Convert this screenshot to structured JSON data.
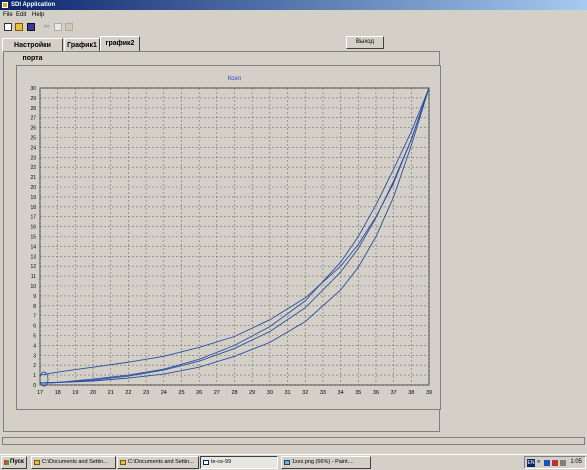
{
  "window": {
    "title": "SDI Application"
  },
  "menu": [
    "File",
    "Edit",
    "Help"
  ],
  "toolbar": {
    "icons": [
      "new-icon",
      "open-icon",
      "save-icon",
      "cut-icon",
      "copy-icon",
      "paste-icon"
    ]
  },
  "tabs": [
    "Настройки порта",
    "График1",
    "график2"
  ],
  "active_tab": 2,
  "exit_button": "Выход",
  "colors": {
    "series": "#2a4fa0",
    "grid": "#707070",
    "accent": "#0a246a"
  },
  "chart_data": {
    "type": "line",
    "title": "Ксил",
    "xlabel": "",
    "ylabel": "",
    "xlim": [
      17,
      39
    ],
    "ylim": [
      0,
      30
    ],
    "x_ticks": [
      17,
      18,
      19,
      20,
      21,
      22,
      23,
      24,
      25,
      26,
      27,
      28,
      29,
      30,
      31,
      32,
      33,
      34,
      35,
      36,
      37,
      38,
      39
    ],
    "y_ticks": [
      0,
      1,
      2,
      3,
      4,
      5,
      6,
      7,
      8,
      9,
      10,
      11,
      12,
      13,
      14,
      15,
      16,
      17,
      18,
      19,
      20,
      21,
      22,
      23,
      24,
      25,
      26,
      27,
      28,
      29,
      30
    ],
    "grid": true,
    "series": [
      {
        "x": [
          17,
          18,
          20,
          22,
          24,
          26,
          28,
          30,
          32,
          34,
          35,
          36,
          37,
          38,
          39
        ],
        "y": [
          1.0,
          1.3,
          1.8,
          2.3,
          2.9,
          3.8,
          4.9,
          6.6,
          8.8,
          12.0,
          14.2,
          17.0,
          20.4,
          24.8,
          30.0
        ]
      },
      {
        "x": [
          17,
          18,
          20,
          22,
          24,
          26,
          28,
          30,
          32,
          34,
          35,
          36,
          37,
          38,
          39
        ],
        "y": [
          0.2,
          0.25,
          0.5,
          0.9,
          1.5,
          2.4,
          3.7,
          5.4,
          7.8,
          11.4,
          13.8,
          16.9,
          20.6,
          24.8,
          30.0
        ]
      },
      {
        "x": [
          17,
          18,
          20,
          22,
          24,
          26,
          28,
          30,
          32,
          34,
          35,
          36,
          37,
          38,
          39
        ],
        "y": [
          0.2,
          0.25,
          0.6,
          1.0,
          1.6,
          2.6,
          4.0,
          5.9,
          8.5,
          12.4,
          15.0,
          18.2,
          21.8,
          25.6,
          30.0
        ]
      },
      {
        "x": [
          17,
          18,
          20,
          22,
          24,
          26,
          28,
          30,
          32,
          34,
          35,
          36,
          37,
          38,
          39
        ],
        "y": [
          0.2,
          0.25,
          0.4,
          0.7,
          1.1,
          1.8,
          2.9,
          4.3,
          6.4,
          9.6,
          11.9,
          15.0,
          19.0,
          24.2,
          30.0
        ]
      }
    ]
  },
  "statusbar": "",
  "taskbar": {
    "start": "Пуск",
    "tasks": [
      "C:\\Documents and Settin...",
      "C:\\Documents and Settin...",
      "te-ce-99",
      "1ххх.png (66%) - Paint...."
    ],
    "active_task": 2,
    "tray_lang": "EN",
    "clock": "1:05"
  }
}
